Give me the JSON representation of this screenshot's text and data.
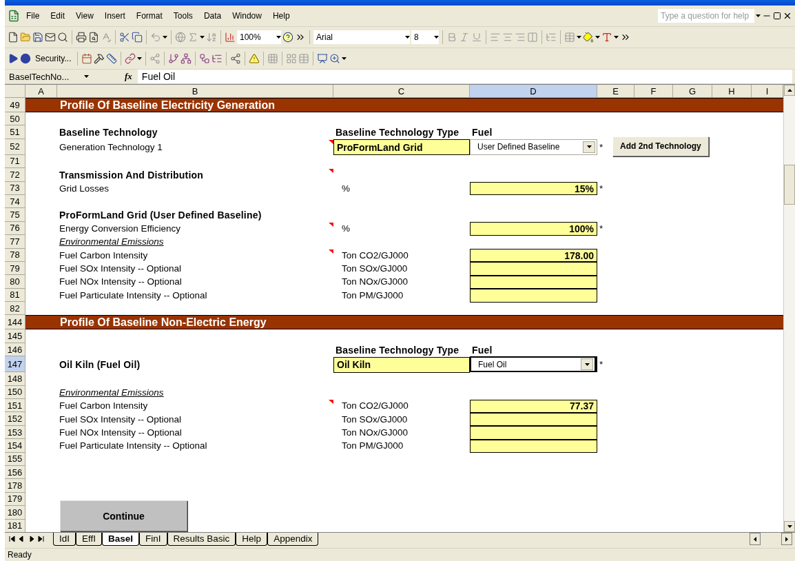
{
  "menu": [
    "File",
    "Edit",
    "View",
    "Insert",
    "Format",
    "Tools",
    "Data",
    "Window",
    "Help"
  ],
  "help_box": {
    "placeholder": "Type a question for help"
  },
  "toolbar": {
    "zoom": "100%",
    "font": "Arial",
    "font_size": "8",
    "security": "Security..."
  },
  "formula_bar": {
    "name_box": "BaselTechNo...",
    "function_label": "fx",
    "value": "Fuel Oil"
  },
  "columns": [
    {
      "label": "A",
      "selected": false
    },
    {
      "label": "B",
      "selected": false
    },
    {
      "label": "C",
      "selected": false
    },
    {
      "label": "D",
      "selected": true
    },
    {
      "label": "E",
      "selected": false
    },
    {
      "label": "F",
      "selected": false
    },
    {
      "label": "G",
      "selected": false
    },
    {
      "label": "H",
      "selected": false
    },
    {
      "label": "I",
      "selected": false
    }
  ],
  "rows": [
    {
      "number": "49",
      "selected": false,
      "kind": "section",
      "title": "Profile Of Baseline Electricity Generation"
    },
    {
      "number": "50",
      "selected": false,
      "kind": "blank"
    },
    {
      "number": "51",
      "selected": false,
      "kind": "data",
      "comment": false,
      "cells": {
        "b": {
          "kind": "heading",
          "text": "Baseline Technology"
        },
        "c": {
          "kind": "heading",
          "text": "Baseline Technology Type"
        },
        "d": {
          "kind": "heading",
          "text": "Fuel"
        }
      }
    },
    {
      "number": "52",
      "selected": false,
      "kind": "data",
      "comment": true,
      "cells": {
        "b": {
          "kind": "label",
          "text": "Generation Technology 1"
        },
        "c": {
          "kind": "input",
          "text": "ProFormLand Grid"
        },
        "d": {
          "kind": "dropdown",
          "text": "User Defined Baseline"
        },
        "e": {
          "kind": "flag",
          "text": "*"
        }
      },
      "button": {
        "label": "Add 2nd Technology"
      }
    },
    {
      "number": "71",
      "selected": false,
      "kind": "blank"
    },
    {
      "number": "72",
      "selected": false,
      "kind": "data",
      "comment": true,
      "cells": {
        "b": {
          "kind": "heading",
          "text": "Transmission And Distribution"
        }
      }
    },
    {
      "number": "73",
      "selected": false,
      "kind": "data",
      "comment": false,
      "cells": {
        "b": {
          "kind": "label",
          "text": "Grid Losses"
        },
        "c": {
          "kind": "unit",
          "text": "%"
        },
        "d": {
          "kind": "input",
          "text": "15%"
        },
        "e": {
          "kind": "flag",
          "text": "*"
        }
      }
    },
    {
      "number": "74",
      "selected": false,
      "kind": "blank"
    },
    {
      "number": "75",
      "selected": false,
      "kind": "data",
      "comment": false,
      "cells": {
        "b": {
          "kind": "heading",
          "text": "ProFormLand Grid (User Defined Baseline)"
        }
      }
    },
    {
      "number": "76",
      "selected": false,
      "kind": "data",
      "comment": true,
      "cells": {
        "b": {
          "kind": "label",
          "text": "Energy Conversion Efficiency"
        },
        "c": {
          "kind": "unit",
          "text": "%"
        },
        "d": {
          "kind": "input",
          "text": "100%"
        },
        "e": {
          "kind": "flag",
          "text": "*"
        }
      }
    },
    {
      "number": "77",
      "selected": false,
      "kind": "data",
      "comment": false,
      "cells": {
        "b": {
          "kind": "subheading",
          "text": "Environmental Emissions"
        }
      }
    },
    {
      "number": "78",
      "selected": false,
      "kind": "data",
      "comment": true,
      "cells": {
        "b": {
          "kind": "label",
          "text": "Fuel Carbon Intensity"
        },
        "c": {
          "kind": "unit",
          "text": "Ton CO2/GJ000"
        },
        "d": {
          "kind": "input",
          "text": "178.00"
        }
      }
    },
    {
      "number": "79",
      "selected": false,
      "kind": "data",
      "comment": false,
      "cells": {
        "b": {
          "kind": "label",
          "text": "Fuel SOx Intensity -- Optional"
        },
        "c": {
          "kind": "unit",
          "text": "Ton SOx/GJ000"
        },
        "d": {
          "kind": "input"
        }
      }
    },
    {
      "number": "80",
      "selected": false,
      "kind": "data",
      "comment": false,
      "cells": {
        "b": {
          "kind": "label",
          "text": "Fuel NOx Intensity -- Optional"
        },
        "c": {
          "kind": "unit",
          "text": "Ton NOx/GJ000"
        },
        "d": {
          "kind": "input"
        }
      }
    },
    {
      "number": "81",
      "selected": false,
      "kind": "data",
      "comment": false,
      "cells": {
        "b": {
          "kind": "label",
          "text": "Fuel Particulate Intensity -- Optional"
        },
        "c": {
          "kind": "unit",
          "text": "Ton PM/GJ000"
        },
        "d": {
          "kind": "input"
        }
      }
    },
    {
      "number": "82",
      "selected": false,
      "kind": "blank"
    },
    {
      "number": "144",
      "selected": false,
      "kind": "section",
      "title": "Profile Of Baseline Non-Electric Energy"
    },
    {
      "number": "145",
      "selected": false,
      "kind": "blank"
    },
    {
      "number": "146",
      "selected": false,
      "kind": "data",
      "comment": false,
      "cells": {
        "c": {
          "kind": "heading",
          "text": "Baseline Technology Type"
        },
        "d": {
          "kind": "heading",
          "text": "Fuel"
        }
      }
    },
    {
      "number": "147",
      "selected": true,
      "kind": "data",
      "comment": false,
      "cells": {
        "b": {
          "kind": "heading",
          "text": "Oil Kiln (Fuel Oil)"
        },
        "c": {
          "kind": "input",
          "text": "Oil Kiln"
        },
        "d": {
          "kind": "dropdown",
          "text": "Fuel Oil"
        },
        "e": {
          "kind": "flag",
          "text": "*"
        }
      }
    },
    {
      "number": "148",
      "selected": false,
      "kind": "blank"
    },
    {
      "number": "150",
      "selected": false,
      "kind": "data",
      "comment": false,
      "cells": {
        "b": {
          "kind": "subheading",
          "text": "Environmental Emissions"
        }
      }
    },
    {
      "number": "151",
      "selected": false,
      "kind": "data",
      "comment": true,
      "cells": {
        "b": {
          "kind": "label",
          "text": "Fuel Carbon Intensity"
        },
        "c": {
          "kind": "unit",
          "text": "Ton CO2/GJ000"
        },
        "d": {
          "kind": "input",
          "text": "77.37"
        }
      }
    },
    {
      "number": "152",
      "selected": false,
      "kind": "data",
      "comment": false,
      "cells": {
        "b": {
          "kind": "label",
          "text": "Fuel SOx Intensity -- Optional"
        },
        "c": {
          "kind": "unit",
          "text": "Ton SOx/GJ000"
        },
        "d": {
          "kind": "input"
        }
      }
    },
    {
      "number": "153",
      "selected": false,
      "kind": "data",
      "comment": false,
      "cells": {
        "b": {
          "kind": "label",
          "text": "Fuel NOx Intensity -- Optional"
        },
        "c": {
          "kind": "unit",
          "text": "Ton NOx/GJ000"
        },
        "d": {
          "kind": "input"
        }
      }
    },
    {
      "number": "154",
      "selected": false,
      "kind": "data",
      "comment": false,
      "cells": {
        "b": {
          "kind": "label",
          "text": "Fuel Particulate Intensity -- Optional"
        },
        "c": {
          "kind": "unit",
          "text": "Ton PM/GJ000"
        },
        "d": {
          "kind": "input"
        }
      }
    },
    {
      "number": "155",
      "selected": false,
      "kind": "blank"
    },
    {
      "number": "156",
      "selected": false,
      "kind": "blank"
    },
    {
      "number": "178",
      "selected": false,
      "kind": "blank"
    },
    {
      "number": "179",
      "selected": false,
      "kind": "blank"
    },
    {
      "number": "180",
      "selected": false,
      "kind": "blank"
    },
    {
      "number": "181",
      "selected": false,
      "kind": "blank"
    }
  ],
  "sheet_button": {
    "label": "Continue"
  },
  "sheet_tabs": [
    {
      "label": "IdI",
      "selected": false
    },
    {
      "label": "EffI",
      "selected": false
    },
    {
      "label": "BaseI",
      "selected": true
    },
    {
      "label": "FinI",
      "selected": false
    },
    {
      "label": "Results Basic",
      "selected": false
    },
    {
      "label": "Help",
      "selected": false
    },
    {
      "label": "Appendix",
      "selected": false
    }
  ],
  "status_bar": {
    "text": "Ready"
  }
}
